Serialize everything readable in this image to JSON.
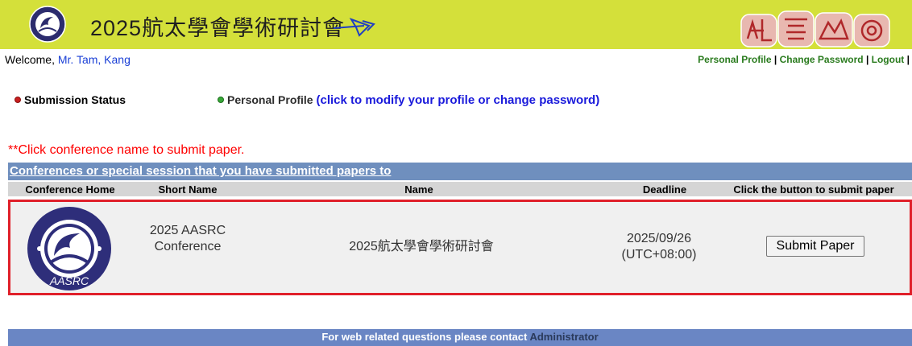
{
  "banner": {
    "title": "2025航太學會學術研討會"
  },
  "welcome": {
    "prefix": "Welcome, ",
    "user_name": "Mr. Tam, Kang"
  },
  "top_links": {
    "profile": "Personal Profile",
    "change_password": "Change Password",
    "logout": "Logout",
    "separator": " | "
  },
  "nav": {
    "submission_status": "Submission Status",
    "personal_profile": "Personal Profile ",
    "profile_hint": "(click to modify your profile or change password)"
  },
  "note": "**Click conference name to submit paper.",
  "table": {
    "heading": "Conferences or special session that you have submitted papers to",
    "columns": {
      "home": "Conference Home",
      "short_name": "Short Name",
      "name": "Name",
      "deadline": "Deadline",
      "action": "Click the button to submit paper"
    },
    "rows": [
      {
        "logo_label": "AASRC",
        "short_name_line1": "2025 AASRC",
        "short_name_line2": "Conference",
        "name": "2025航太學會學術研討會",
        "deadline_line1": "2025/09/26",
        "deadline_line2": "(UTC+08:00)",
        "button_label": "Submit Paper"
      }
    ]
  },
  "footer": {
    "text": "For web related questions please contact ",
    "admin": "Administrator"
  },
  "colors": {
    "banner_bg": "#d4e03a",
    "table_header_bg": "#6f8fbe",
    "footer_bg": "#6a86c4",
    "row_highlight_border": "#e0202a",
    "note_text": "#ff0000",
    "link_green": "#2a7b1e",
    "hint_blue": "#1a1adb"
  },
  "icons": [
    "society-seal-icon",
    "paper-plane-icon",
    "banner-decoration-icon",
    "red-dot-icon",
    "green-dot-icon"
  ]
}
